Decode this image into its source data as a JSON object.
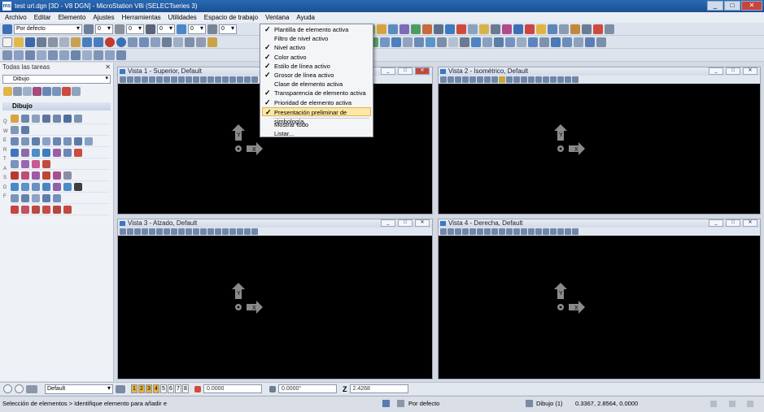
{
  "window": {
    "title": "test url.dgn [3D - V8 DGN] - MicroStation V8i (SELECTseries 3)",
    "app_icon": "ms",
    "min": "_",
    "max": "□",
    "close": "✕"
  },
  "menu": [
    "Archivo",
    "Editar",
    "Elemento",
    "Ajustes",
    "Herramientas",
    "Utilidades",
    "Espacio de trabajo",
    "Ventana",
    "Ayuda"
  ],
  "toolbar": {
    "style_select": "Por defecto",
    "n1": "0",
    "n2": "0",
    "n3": "0",
    "n4": "0",
    "n5": "0"
  },
  "task_panel": {
    "title": "Todas las tareas",
    "close": "✕",
    "task_select": "Dibujo",
    "group": "Dibujo",
    "letters": [
      "Q",
      "W",
      "E",
      "R",
      "T",
      "A",
      "S",
      "D",
      "F"
    ]
  },
  "views": [
    {
      "title": "Vista 1 - Superior, Default"
    },
    {
      "title": "Vista 2 - Isométrico, Default"
    },
    {
      "title": "Vista 3 - Alzado, Default"
    },
    {
      "title": "Vista 4 - Derecha, Default"
    }
  ],
  "axis_labels": {
    "y": "Y",
    "x": "X"
  },
  "bottom_bar": {
    "default_select": "Default",
    "levels": [
      "1",
      "2",
      "3",
      "4",
      "5",
      "6",
      "7",
      "8"
    ],
    "field1": "0.0000",
    "field2": "0.0000°",
    "z_label": "Z",
    "z_value": "2.4268"
  },
  "status_bar": {
    "prompt": "Selección de elementos > Identifique elemento para añadir e",
    "style": "Por defecto",
    "model": "Dibujo (1)",
    "coords": "0.3367, 2.8564, 0.0000"
  },
  "dropdown": {
    "items": [
      {
        "label": "Plantilla de elemento activa",
        "checked": "✓"
      },
      {
        "label": "Filtro de nivel activo",
        "checked": ""
      },
      {
        "label": "Nivel activo",
        "checked": "✓"
      },
      {
        "label": "Color activo",
        "checked": "✓"
      },
      {
        "label": "Estilo de línea activo",
        "checked": "✓"
      },
      {
        "label": "Grosor de línea activo",
        "checked": "✓"
      },
      {
        "label": "Clase de elemento activa",
        "checked": ""
      },
      {
        "label": "Transparencia de elemento activa",
        "checked": "✓"
      },
      {
        "label": "Prioridad de elemento activa",
        "checked": "✓"
      },
      {
        "label": "Presentación preliminar de simbología",
        "checked": "✓"
      }
    ],
    "extra": [
      "Mostrar todo",
      "Listar..."
    ]
  },
  "colors": {
    "highlight": "#fbe7a6",
    "view_bg": "#000000",
    "axis": "#8a8a8a"
  }
}
